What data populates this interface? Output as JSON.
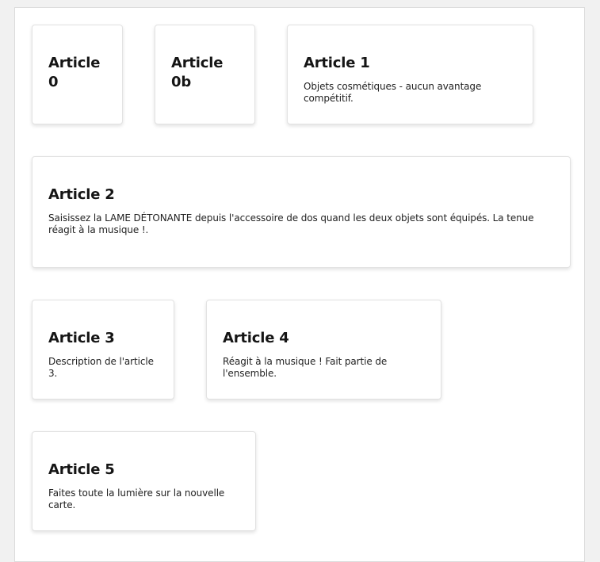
{
  "articles": [
    {
      "title": "Article 0",
      "description": ""
    },
    {
      "title": "Article 0b",
      "description": ""
    },
    {
      "title": "Article 1",
      "description": "Objets cosmétiques - aucun avantage compétitif."
    },
    {
      "title": "Article 2",
      "description": "Saisissez la LAME DÉTONANTE depuis l'accessoire de dos quand les deux objets sont équipés. La tenue réagit à la musique !."
    },
    {
      "title": "Article 3",
      "description": "Description de l'article 3."
    },
    {
      "title": "Article 4",
      "description": "Réagit à la musique ! Fait partie de l'ensemble."
    },
    {
      "title": "Article 5",
      "description": "Faites toute la lumière sur la nouvelle carte."
    }
  ]
}
